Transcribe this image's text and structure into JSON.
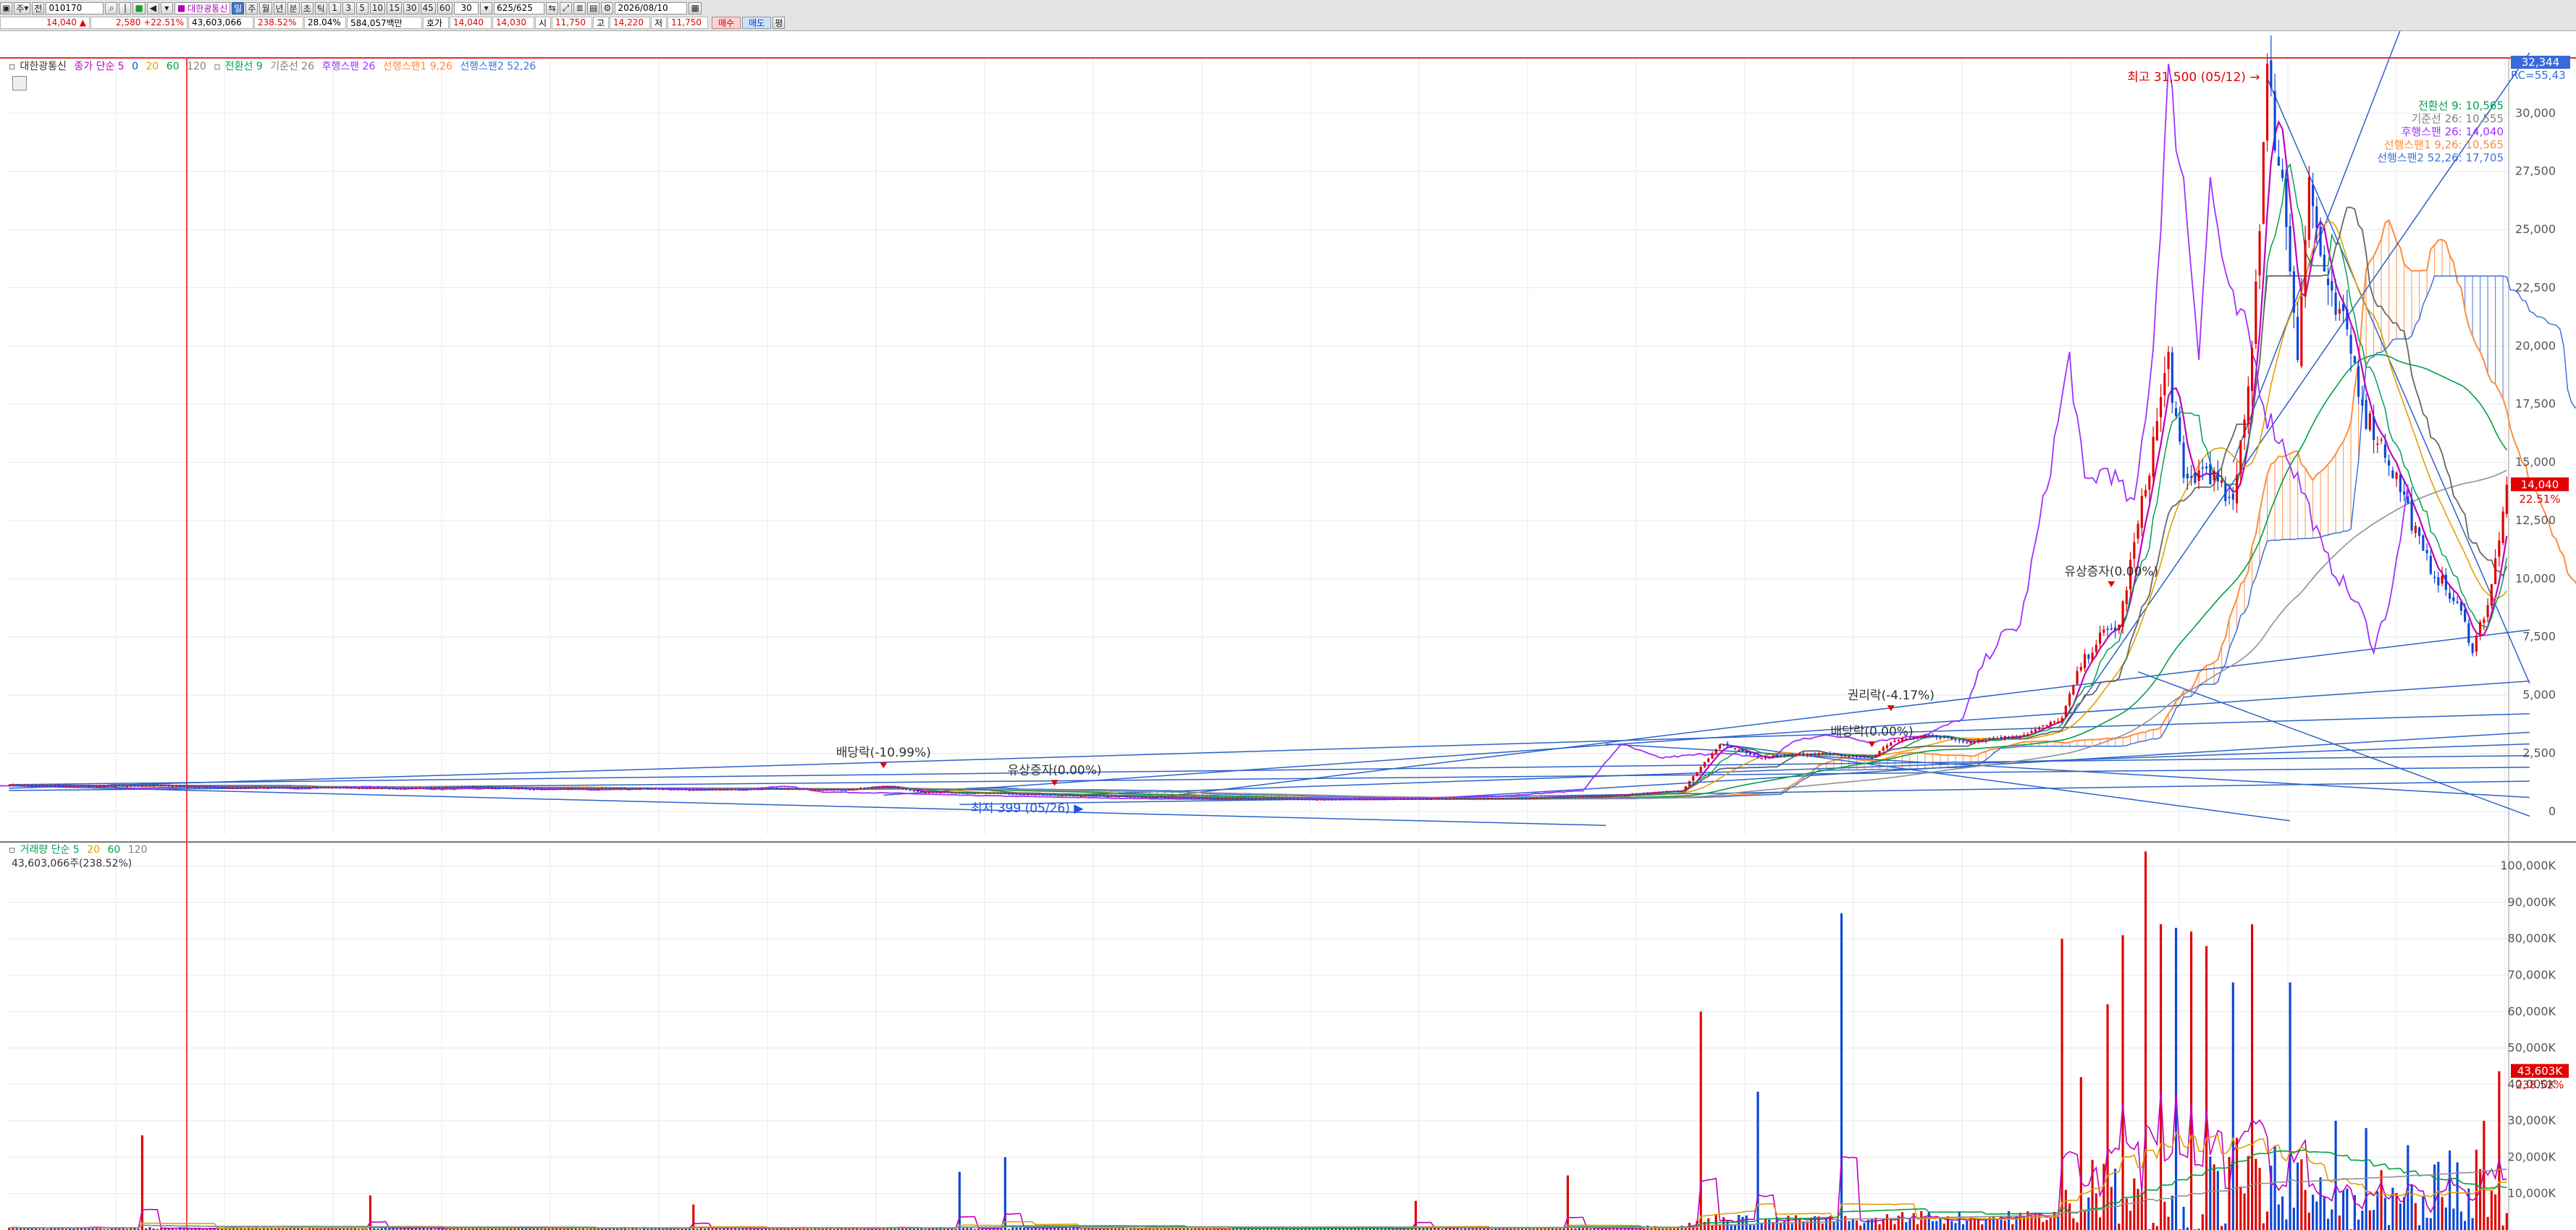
{
  "toolbar": {
    "mode_label": "주",
    "type_label": "전",
    "code": "010170",
    "stock_name": "대한광통신",
    "periods": [
      "일",
      "주",
      "월",
      "년",
      "분",
      "초",
      "틱"
    ],
    "active_period": "일",
    "intervals": [
      "1",
      "3",
      "5",
      "10",
      "15",
      "30",
      "45",
      "60"
    ],
    "interval_value": "30",
    "count": "625",
    "count_total": "/625",
    "date": "2026/08/10",
    "flag_label": "평"
  },
  "quote": {
    "price": "14,040",
    "change_arrow": "▲",
    "change": "2,580",
    "change_pct": "+22.51%",
    "volume": "43,603,066",
    "volume_ratio": "238.52%",
    "turnover_ratio": "28.04%",
    "amount": "584,057백만",
    "ask_label": "호가",
    "ask1": "14,040",
    "ask2": "14,030",
    "open_label": "시",
    "open": "11,750",
    "high_label": "고",
    "high": "14,220",
    "low_label": "저",
    "low": "11,750",
    "buy_label": "매수",
    "sell_label": "매도"
  },
  "colors": {
    "up": "#e00000",
    "down": "#0a46d8",
    "ma5": "#c000c0",
    "ma20": "#e0a000",
    "ma60": "#00a040",
    "ma120": "#909090",
    "conversion": "#00a050",
    "base": "#909090",
    "lagging": "#a030ff",
    "span1": "#ff8c3c",
    "span2": "#3c70e0",
    "trendline": "#2a62c8",
    "gridline": "#e4e8ee"
  },
  "price_legend": {
    "name": "대한광통신",
    "ma_label": "종가 단순 5",
    "ma_periods": [
      "0",
      "20",
      "60",
      "120"
    ],
    "ichimoku": [
      "전환선 9",
      "기준선 26",
      "후행스팬 26",
      "선행스팬1 9,26",
      "선행스팬2 52,26"
    ]
  },
  "volume_legend": {
    "name": "거래량 단순 5",
    "periods": [
      "20",
      "60",
      "120"
    ],
    "current": "43,603,066주(238.52%)"
  },
  "chart_data": [
    {
      "type": "candlestick",
      "panel": "price",
      "x_label": "",
      "y_label": "",
      "ylim": [
        -1000,
        32344
      ],
      "y_ticks": [
        "0",
        "2,500",
        "5,000",
        "7,500",
        "10,000",
        "12,500",
        "15,000",
        "17,500",
        "20,000",
        "22,500",
        "25,000",
        "27,500",
        "30,000"
      ],
      "axis_top_value": "32,344",
      "axis_top_sub": "RC=55,43",
      "last_price_label": "14,040",
      "last_change_label": "22.51%",
      "max_annotation": "최고 31,500 (05/12)",
      "min_annotation": "최저 399 (05/26)",
      "events": [
        {
          "label": "배당락(-10.99%)",
          "bar": 230
        },
        {
          "label": "유상증자(0.00%)",
          "bar": 275
        },
        {
          "label": "권리락(-4.17%)",
          "bar": 495
        },
        {
          "label": "배당락(0.00%)",
          "bar": 490
        },
        {
          "label": "유상증자(0.00%)",
          "bar": 553
        }
      ],
      "ichimoku_labels": [
        "전환선 9: 10,565",
        "기준선 26: 10,555",
        "후행스팬 26: 14,040",
        "선행스팬1 9,26: 10,565",
        "선행스팬2 52,26: 17,705"
      ],
      "anchors": [
        [
          0,
          1150
        ],
        [
          20,
          1080
        ],
        [
          40,
          1120
        ],
        [
          60,
          1000
        ],
        [
          80,
          1050
        ],
        [
          100,
          980
        ],
        [
          120,
          1060
        ],
        [
          140,
          950
        ],
        [
          160,
          1000
        ],
        [
          180,
          930
        ],
        [
          200,
          980
        ],
        [
          220,
          930
        ],
        [
          230,
          1100
        ],
        [
          240,
          840
        ],
        [
          260,
          780
        ],
        [
          275,
          700
        ],
        [
          300,
          620
        ],
        [
          320,
          560
        ],
        [
          340,
          520
        ],
        [
          360,
          520
        ],
        [
          380,
          560
        ],
        [
          400,
          580
        ],
        [
          420,
          680
        ],
        [
          440,
          900
        ],
        [
          450,
          2900
        ],
        [
          460,
          2300
        ],
        [
          475,
          2500
        ],
        [
          490,
          2300
        ],
        [
          495,
          3000
        ],
        [
          505,
          3300
        ],
        [
          515,
          3000
        ],
        [
          530,
          3300
        ],
        [
          540,
          4000
        ],
        [
          545,
          6300
        ],
        [
          550,
          7500
        ],
        [
          555,
          8000
        ],
        [
          562,
          14000
        ],
        [
          568,
          19500
        ],
        [
          572,
          14000
        ],
        [
          578,
          14800
        ],
        [
          585,
          13000
        ],
        [
          590,
          20000
        ],
        [
          594,
          31500
        ],
        [
          598,
          27000
        ],
        [
          602,
          20000
        ],
        [
          605,
          27000
        ],
        [
          610,
          22000
        ],
        [
          615,
          20500
        ],
        [
          620,
          17000
        ],
        [
          625,
          15500
        ],
        [
          630,
          13500
        ],
        [
          635,
          11000
        ],
        [
          640,
          9800
        ],
        [
          645,
          8500
        ],
        [
          648,
          7000
        ],
        [
          652,
          9000
        ],
        [
          655,
          11500
        ],
        [
          657,
          14040
        ]
      ]
    },
    {
      "type": "bar",
      "panel": "volume",
      "y_ticks": [
        "10,000K",
        "20,000K",
        "30,000K",
        "40,000K",
        "50,000K",
        "60,000K",
        "70,000K",
        "80,000K",
        "90,000K",
        "100,000K"
      ],
      "ylim": [
        0,
        105000
      ],
      "last_volume_label": "43,603K",
      "last_volume_pct": "238.52%",
      "spikes": [
        [
          35,
          26000
        ],
        [
          95,
          9500
        ],
        [
          180,
          7000
        ],
        [
          250,
          16000
        ],
        [
          262,
          20000
        ],
        [
          370,
          8000
        ],
        [
          410,
          15000
        ],
        [
          445,
          60000
        ],
        [
          460,
          38000
        ],
        [
          482,
          87000
        ],
        [
          540,
          80000
        ],
        [
          545,
          42000
        ],
        [
          552,
          62000
        ],
        [
          556,
          81000
        ],
        [
          562,
          104000
        ],
        [
          566,
          84000
        ],
        [
          570,
          83000
        ],
        [
          574,
          82000
        ],
        [
          578,
          78000
        ],
        [
          585,
          68000
        ],
        [
          590,
          84000
        ],
        [
          600,
          68000
        ],
        [
          612,
          30000
        ],
        [
          620,
          28000
        ],
        [
          638,
          18000
        ],
        [
          651,
          30000
        ],
        [
          655,
          43603
        ]
      ]
    }
  ]
}
